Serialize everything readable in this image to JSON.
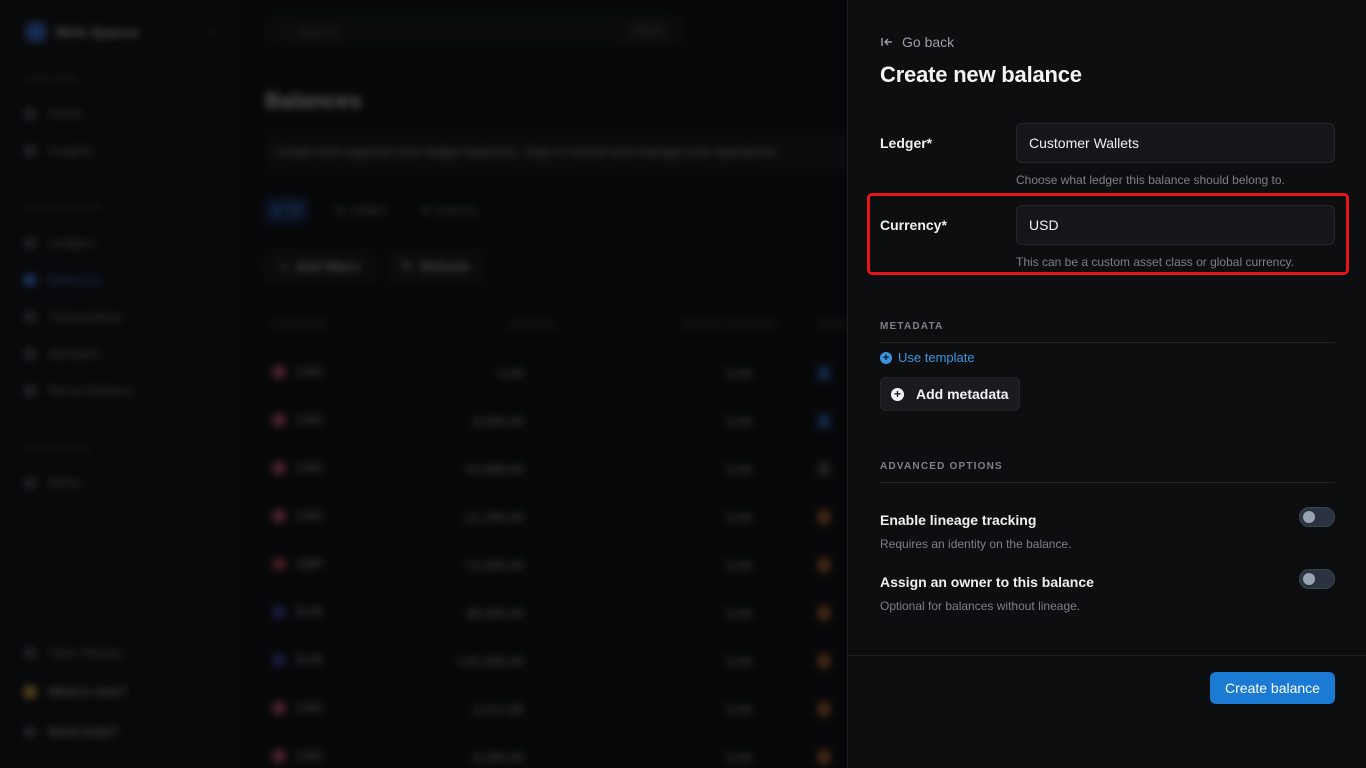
{
  "background": {
    "workspace": "Blnk Spaces",
    "sidebar_sections": [
      {
        "title": "Personal",
        "items": [
          "Home",
          "Insights"
        ]
      },
      {
        "title": "Main Section",
        "items": [
          "Ledgers",
          "Balances",
          "Transactions",
          "Identities",
          "Reconciliations"
        ]
      },
      {
        "title": "Monitoring",
        "items": [
          "Alerts"
        ]
      }
    ],
    "sidebar_footer": [
      "Open Money",
      "What's new?",
      "Need help?"
    ],
    "search_placeholder": "Search",
    "search_kbd": "Ctrl K",
    "page_title": "Balances",
    "page_description": "Create and organize your ledger balances. Stay in control and manage your operations",
    "chips": [
      "All",
      "Inflight",
      "Internal"
    ],
    "actions": [
      "Add filters",
      "Refresh"
    ],
    "table_headers": [
      "CURRENCY",
      "BALANCE",
      "INFLIGHT BALANCE",
      "IDENTITY"
    ],
    "rows": [
      {
        "currency": "USD",
        "balance": "0.00",
        "inflight": "0.00"
      },
      {
        "currency": "USD",
        "balance": "8,500.00",
        "inflight": "0.00"
      },
      {
        "currency": "USD",
        "balance": "53,999.00",
        "inflight": "0.00"
      },
      {
        "currency": "USD",
        "balance": "-21,250.00",
        "inflight": "0.00"
      },
      {
        "currency": "GBP",
        "balance": "-72,000.00",
        "inflight": "0.00"
      },
      {
        "currency": "EUR",
        "balance": "38,000.00",
        "inflight": "0.00"
      },
      {
        "currency": "EUR",
        "balance": "-125,000.00",
        "inflight": "0.00"
      },
      {
        "currency": "USD",
        "balance": "2,017.80",
        "inflight": "0.00"
      },
      {
        "currency": "USD",
        "balance": "-4,200.00",
        "inflight": "0.00"
      }
    ]
  },
  "drawer": {
    "go_back": "Go back",
    "title": "Create new balance",
    "ledger": {
      "label": "Ledger*",
      "value": "Customer Wallets",
      "help": "Choose what ledger this balance should belong to."
    },
    "currency": {
      "label": "Currency*",
      "value": "USD",
      "help": "This can be a custom asset class or global currency."
    },
    "metadata": {
      "section_title": "METADATA",
      "use_template": "Use template",
      "add_metadata": "Add metadata"
    },
    "advanced": {
      "section_title": "ADVANCED OPTIONS",
      "options": [
        {
          "title": "Enable lineage tracking",
          "desc": "Requires an identity on the balance.",
          "enabled": false
        },
        {
          "title": "Assign an owner to this balance",
          "desc": "Optional for balances without lineage.",
          "enabled": false
        }
      ]
    },
    "submit": "Create balance",
    "accent_color": "#1a7ad4",
    "highlight_color": "#e6131a"
  }
}
